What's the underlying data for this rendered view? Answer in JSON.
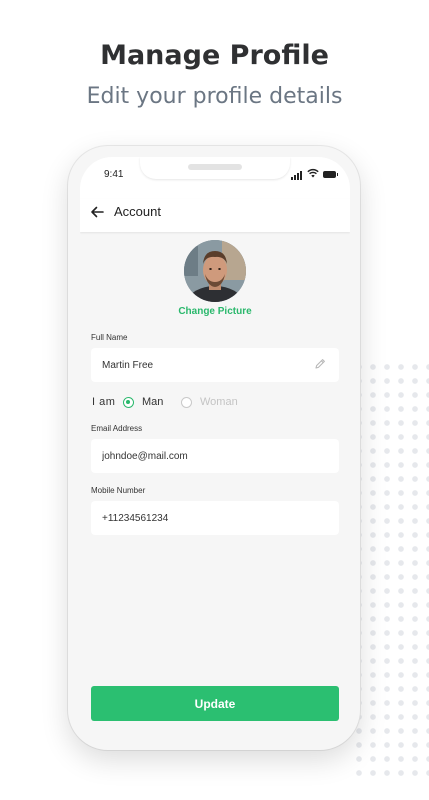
{
  "promo": {
    "headline": "Manage Profile",
    "subheadline": "Edit your profile details"
  },
  "status_bar": {
    "time": "9:41"
  },
  "header": {
    "back_icon": "arrow-left-icon",
    "title": "Account"
  },
  "profile": {
    "change_picture_label": "Change Picture"
  },
  "form": {
    "full_name": {
      "label": "Full Name",
      "value": "Martin Free",
      "icon": "pencil-icon"
    },
    "gender": {
      "label": "I am",
      "options": [
        {
          "label": "Man",
          "selected": true
        },
        {
          "label": "Woman",
          "selected": false
        }
      ]
    },
    "email": {
      "label": "Email Address",
      "value": "johndoe@mail.com"
    },
    "mobile": {
      "label": "Mobile Number",
      "value": "+11234561234"
    },
    "submit_label": "Update"
  },
  "colors": {
    "accent": "#2bbf71",
    "headline": "#2f3032",
    "subheadline": "#6b7683",
    "screen_bg": "#f6f6f6"
  }
}
